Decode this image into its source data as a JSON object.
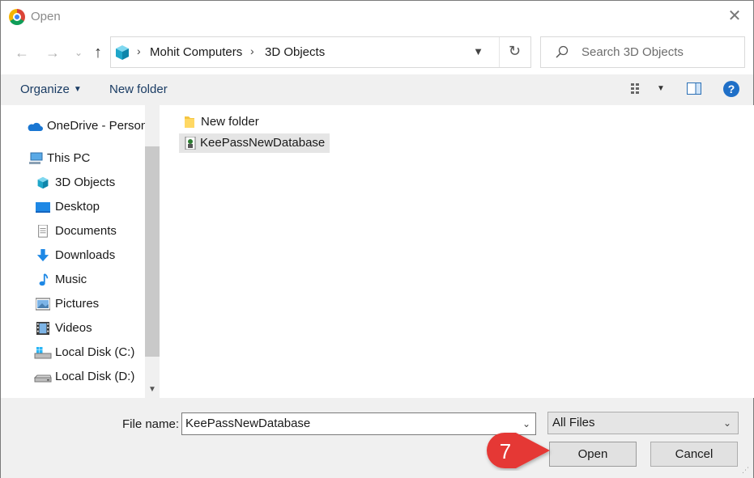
{
  "window": {
    "title": "Open",
    "close_label": "✕"
  },
  "address": {
    "crumbs": [
      "Mohit Computers",
      "3D Objects"
    ],
    "search_placeholder": "Search 3D Objects"
  },
  "toolbar": {
    "organize_label": "Organize",
    "new_folder_label": "New folder"
  },
  "nav": {
    "items": [
      {
        "label": "OneDrive - Person",
        "icon": "onedrive-icon"
      },
      {
        "label": "This PC",
        "icon": "pc-icon"
      },
      {
        "label": "3D Objects",
        "icon": "cube-icon"
      },
      {
        "label": "Desktop",
        "icon": "desktop-icon"
      },
      {
        "label": "Documents",
        "icon": "documents-icon"
      },
      {
        "label": "Downloads",
        "icon": "download-icon"
      },
      {
        "label": "Music",
        "icon": "music-icon"
      },
      {
        "label": "Pictures",
        "icon": "pictures-icon"
      },
      {
        "label": "Videos",
        "icon": "videos-icon"
      },
      {
        "label": "Local Disk (C:)",
        "icon": "drive-c-icon"
      },
      {
        "label": "Local Disk (D:)",
        "icon": "drive-d-icon"
      }
    ]
  },
  "files": [
    {
      "name": "New folder",
      "icon": "folder-icon",
      "selected": false
    },
    {
      "name": "KeePassNewDatabase",
      "icon": "keepass-file-icon",
      "selected": true
    }
  ],
  "footer": {
    "filename_label": "File name:",
    "filename_value": "KeePassNewDatabase",
    "filetype_value": "All Files",
    "open_label": "Open",
    "cancel_label": "Cancel"
  },
  "callout": {
    "step": "7",
    "color": "#e53935"
  },
  "colors": {
    "accent": "#1f6fc7",
    "selection": "#e5e5e5",
    "bar": "#f0f0f0"
  }
}
